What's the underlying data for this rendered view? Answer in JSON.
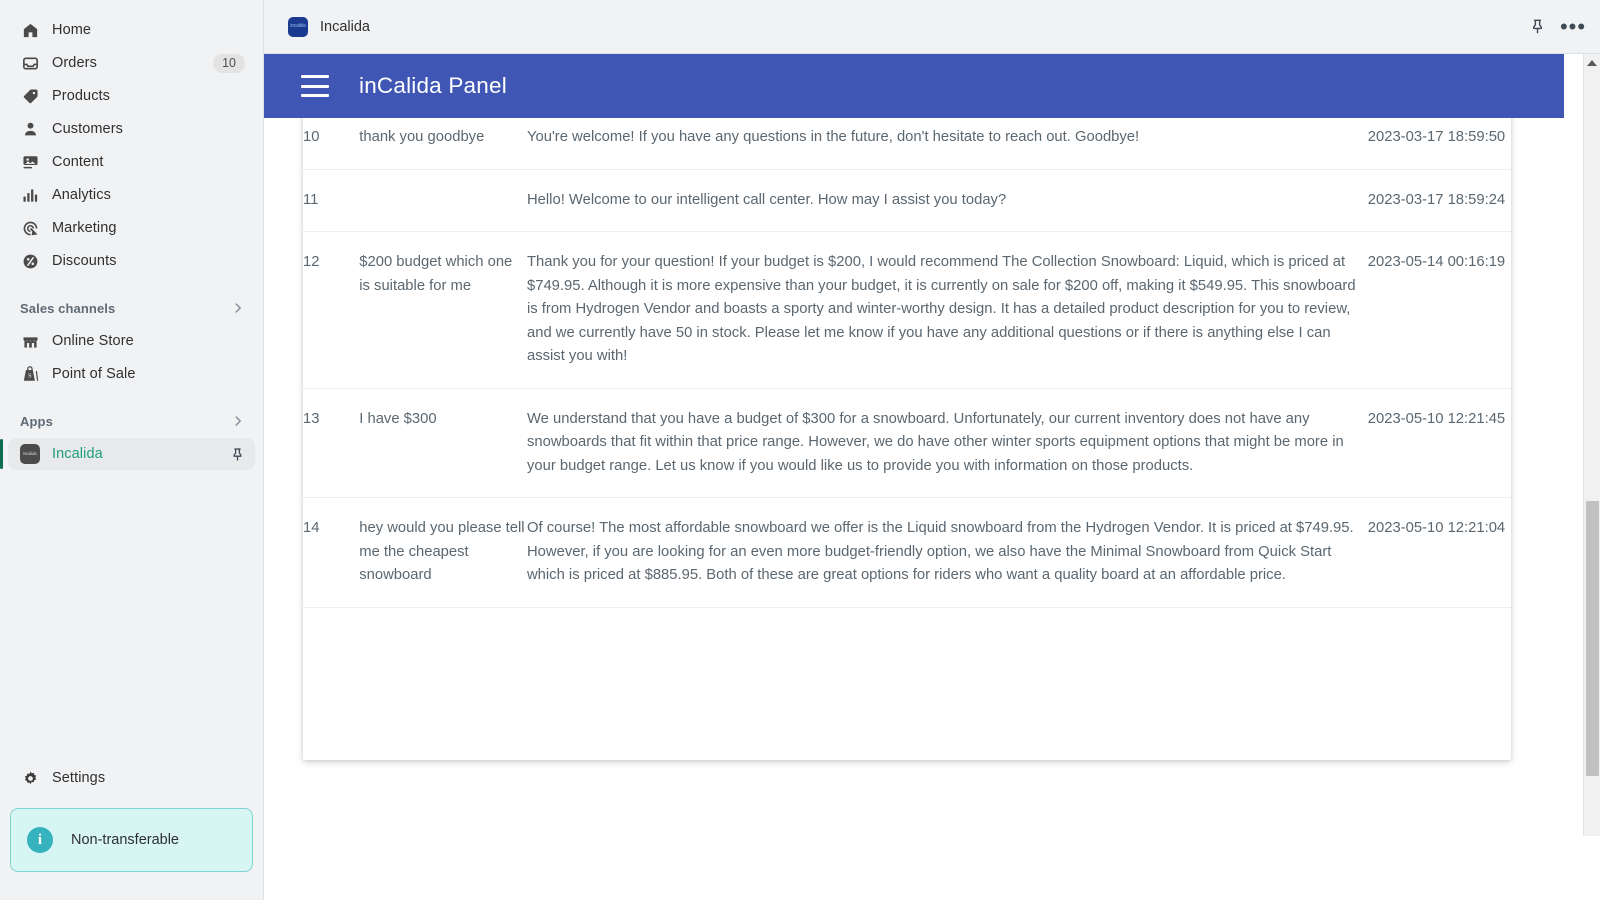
{
  "sidebar": {
    "nav": [
      {
        "label": "Home",
        "icon": "home-icon",
        "badge": ""
      },
      {
        "label": "Orders",
        "icon": "orders-icon",
        "badge": "10"
      },
      {
        "label": "Products",
        "icon": "products-icon",
        "badge": ""
      },
      {
        "label": "Customers",
        "icon": "customers-icon",
        "badge": ""
      },
      {
        "label": "Content",
        "icon": "content-icon",
        "badge": ""
      },
      {
        "label": "Analytics",
        "icon": "analytics-icon",
        "badge": ""
      },
      {
        "label": "Marketing",
        "icon": "marketing-icon",
        "badge": ""
      },
      {
        "label": "Discounts",
        "icon": "discounts-icon",
        "badge": ""
      }
    ],
    "sales_channels": {
      "title": "Sales channels",
      "chevron": "chevron-right-icon",
      "items": [
        {
          "label": "Online Store",
          "icon": "store-icon"
        },
        {
          "label": "Point of Sale",
          "icon": "pos-icon"
        }
      ]
    },
    "apps": {
      "title": "Apps",
      "chevron": "chevron-right-icon",
      "items": [
        {
          "label": "Incalida",
          "icon": "app-tile-icon",
          "tile_text": "incalida",
          "pin": "pin-icon",
          "active": true
        }
      ]
    },
    "settings": {
      "label": "Settings",
      "icon": "gear-icon"
    },
    "notice": {
      "label": "Non-transferable",
      "icon": "info-icon"
    }
  },
  "appbar": {
    "tab_label": "Incalida",
    "tab_tile_text": "incalida",
    "pin_icon": "pin-icon",
    "more_icon": "more-horizontal-icon",
    "more_glyph": "•••"
  },
  "panel": {
    "title": "inCalida Panel",
    "menu_icon": "hamburger-menu-icon"
  },
  "table": {
    "rows": [
      {
        "id": "10",
        "question": "thank you goodbye",
        "answer": "You're welcome! If you have any questions in the future, don't hesitate to reach out. Goodbye!",
        "timestamp": "2023-03-17 18:59:50"
      },
      {
        "id": "11",
        "question": "",
        "answer": "Hello! Welcome to our intelligent call center. How may I assist you today?",
        "timestamp": "2023-03-17 18:59:24"
      },
      {
        "id": "12",
        "question": "$200 budget which one is suitable for me",
        "answer": "Thank you for your question! If your budget is $200, I would recommend The Collection Snowboard: Liquid, which is priced at $749.95. Although it is more expensive than your budget, it is currently on sale for $200 off, making it $549.95. This snowboard is from Hydrogen Vendor and boasts a sporty and winter-worthy design. It has a detailed product description for you to review, and we currently have 50 in stock. Please let me know if you have any additional questions or if there is anything else I can assist you with!",
        "timestamp": "2023-05-14 00:16:19"
      },
      {
        "id": "13",
        "question": "I have $300",
        "answer": "We understand that you have a budget of $300 for a snowboard. Unfortunately, our current inventory does not have any snowboards that fit within that price range. However, we do have other winter sports equipment options that might be more in your budget range. Let us know if you would like us to provide you with information on those products.",
        "timestamp": "2023-05-10 12:21:45"
      },
      {
        "id": "14",
        "question": "hey would you please tell me the cheapest snowboard",
        "answer": "Of course! The most affordable snowboard we offer is the Liquid snowboard from the Hydrogen Vendor. It is priced at $749.95. However, if you are looking for an even more budget-friendly option, we also have the Minimal Snowboard from Quick Start which is priced at $885.95. Both of these are great options for riders who want a quality board at an affordable price.",
        "timestamp": "2023-05-10 12:21:04"
      }
    ]
  },
  "scrollbar": {
    "up_icon": "scroll-up-arrow-icon",
    "down_icon": "scroll-down-arrow-icon"
  },
  "colors": {
    "panel_header_blue": "#3f56b5",
    "sidebar_bg": "#f1f2f4",
    "active_app_text": "#1f9e7e",
    "active_bar": "#0d6b4f",
    "notice_bg": "#d6f5f3",
    "notice_border": "#7fd4d0",
    "notice_icon": "#37b3bd",
    "table_text": "#5b6770"
  }
}
